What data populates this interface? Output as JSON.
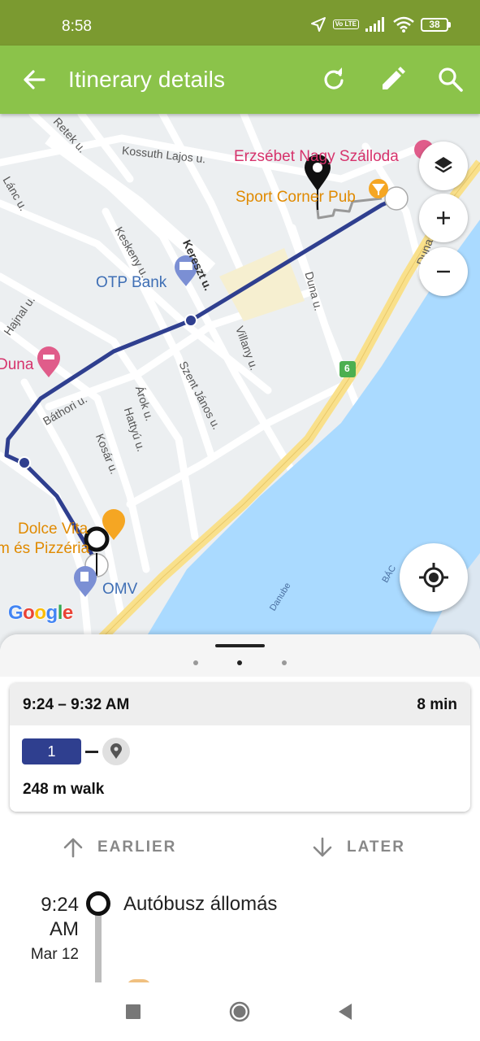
{
  "status_bar": {
    "time": "8:58",
    "volte": "Vo LTE",
    "battery": "38"
  },
  "app_bar": {
    "title": "Itinerary details",
    "back_icon": "arrow-back-icon",
    "actions": [
      "refresh-icon",
      "edit-icon",
      "search-icon"
    ]
  },
  "map": {
    "streets": [
      "Retek u.",
      "Kossuth Lajos u.",
      "Lánc u.",
      "Keskeny u.",
      "Kereszt u.",
      "Duna u.",
      "Hajnal u.",
      "Villany u.",
      "Szent János u.",
      "Árok u.",
      "Báthori u.",
      "Hattyú u.",
      "Kosár u.",
      "Duna",
      "Danube",
      "BÁC"
    ],
    "pois": {
      "hotel": "Erzsébet Nagy Szálloda",
      "pub": "Sport Corner Pub",
      "bank": "OTP Bank",
      "hotel2": "Duna",
      "pizzeria_line1": "Dolce Vita",
      "pizzeria_line2": "m és Pizzéria",
      "fuel": "OMV"
    },
    "road_shield": "6",
    "attribution": "Google",
    "colors": {
      "route": "#2f3f8f",
      "water": "#aadaff",
      "highway": "#f9e08b"
    },
    "controls": [
      "layers-icon",
      "zoom-in-icon",
      "zoom-out-icon",
      "my-location-icon"
    ]
  },
  "sheet": {
    "page_count": 3,
    "active_page": 2,
    "itinerary": {
      "time_range": "9:24 – 9:32 AM",
      "duration": "8 min",
      "route_number": "1",
      "walk": "248 m walk"
    },
    "earlier_label": "EARLIER",
    "later_label": "LATER",
    "leg": {
      "time_line1": "9:24",
      "time_line2": "AM",
      "date": "Mar 12",
      "stop": "Autóbusz állomás"
    }
  },
  "nav_bar": [
    "recent-apps-icon",
    "home-icon",
    "back-icon"
  ]
}
